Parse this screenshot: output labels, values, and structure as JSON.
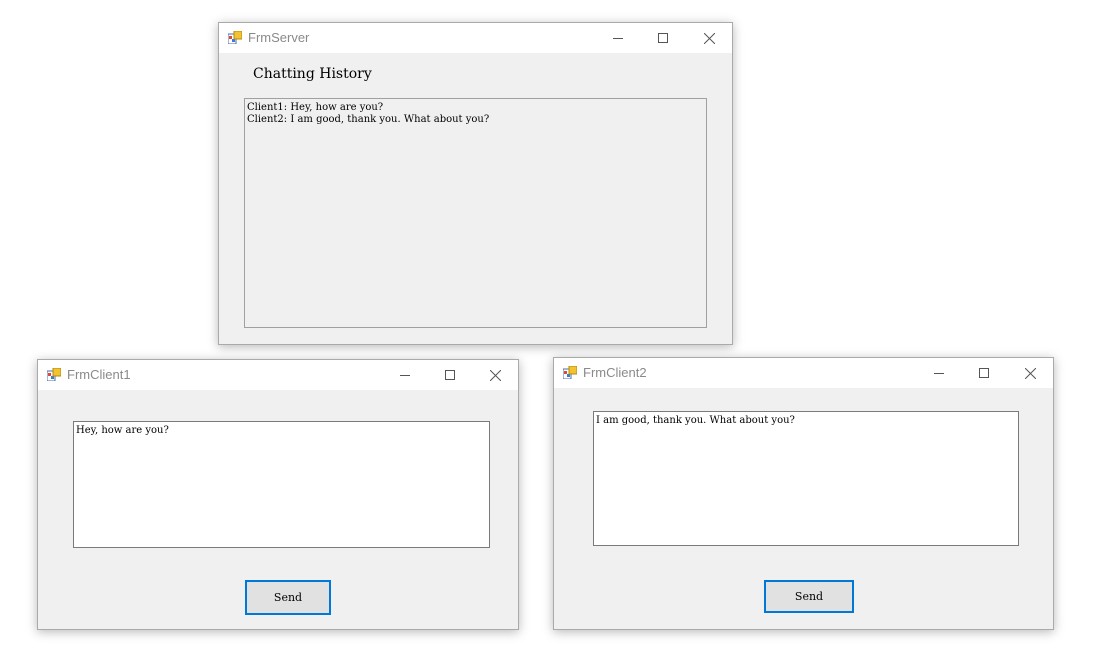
{
  "server": {
    "title": "FrmServer",
    "heading": "Chatting History",
    "history_lines": [
      "Client1: Hey, how are you?",
      "Client2: I am good, thank you. What about you?"
    ]
  },
  "client1": {
    "title": "FrmClient1",
    "message": "Hey, how are you?",
    "send_label": "Send"
  },
  "client2": {
    "title": "FrmClient2",
    "message": "I am good, thank you. What about you?",
    "send_label": "Send"
  },
  "icons": {
    "app": "winforms-app-icon",
    "minimize": "minimize-icon",
    "maximize": "maximize-icon",
    "close": "close-icon"
  }
}
